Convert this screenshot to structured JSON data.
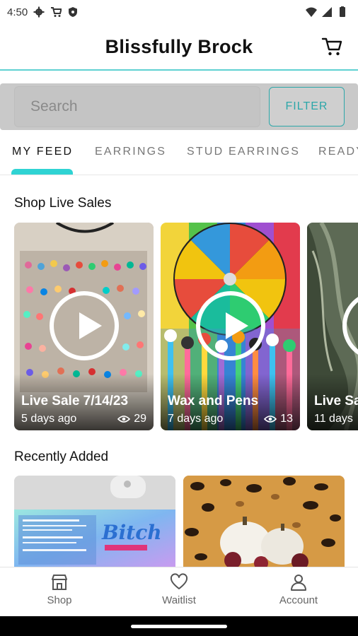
{
  "status_bar": {
    "time": "4:50"
  },
  "app_bar": {
    "title": "Blissfully Brock"
  },
  "search": {
    "placeholder": "Search",
    "filter_label": "FILTER"
  },
  "tabs": [
    "MY FEED",
    "EARRINGS",
    "STUD EARRINGS",
    "READY"
  ],
  "sections": {
    "live": "Shop Live Sales",
    "recent": "Recently Added"
  },
  "live_sales": [
    {
      "title": "Live Sale 7/14/23",
      "ago": "5 days ago",
      "views": "29"
    },
    {
      "title": "Wax and Pens",
      "ago": "7 days ago",
      "views": "13"
    },
    {
      "title": "Live Sa",
      "ago": "11 days"
    }
  ],
  "recent_items": [
    {
      "label_text": "Bitch"
    }
  ],
  "bottom_nav": [
    {
      "label": "Shop",
      "icon": "shop-icon"
    },
    {
      "label": "Waitlist",
      "icon": "heart-icon"
    },
    {
      "label": "Account",
      "icon": "account-icon"
    }
  ],
  "colors": {
    "accent": "#2fd3d3",
    "filter": "#2ca7a9"
  }
}
